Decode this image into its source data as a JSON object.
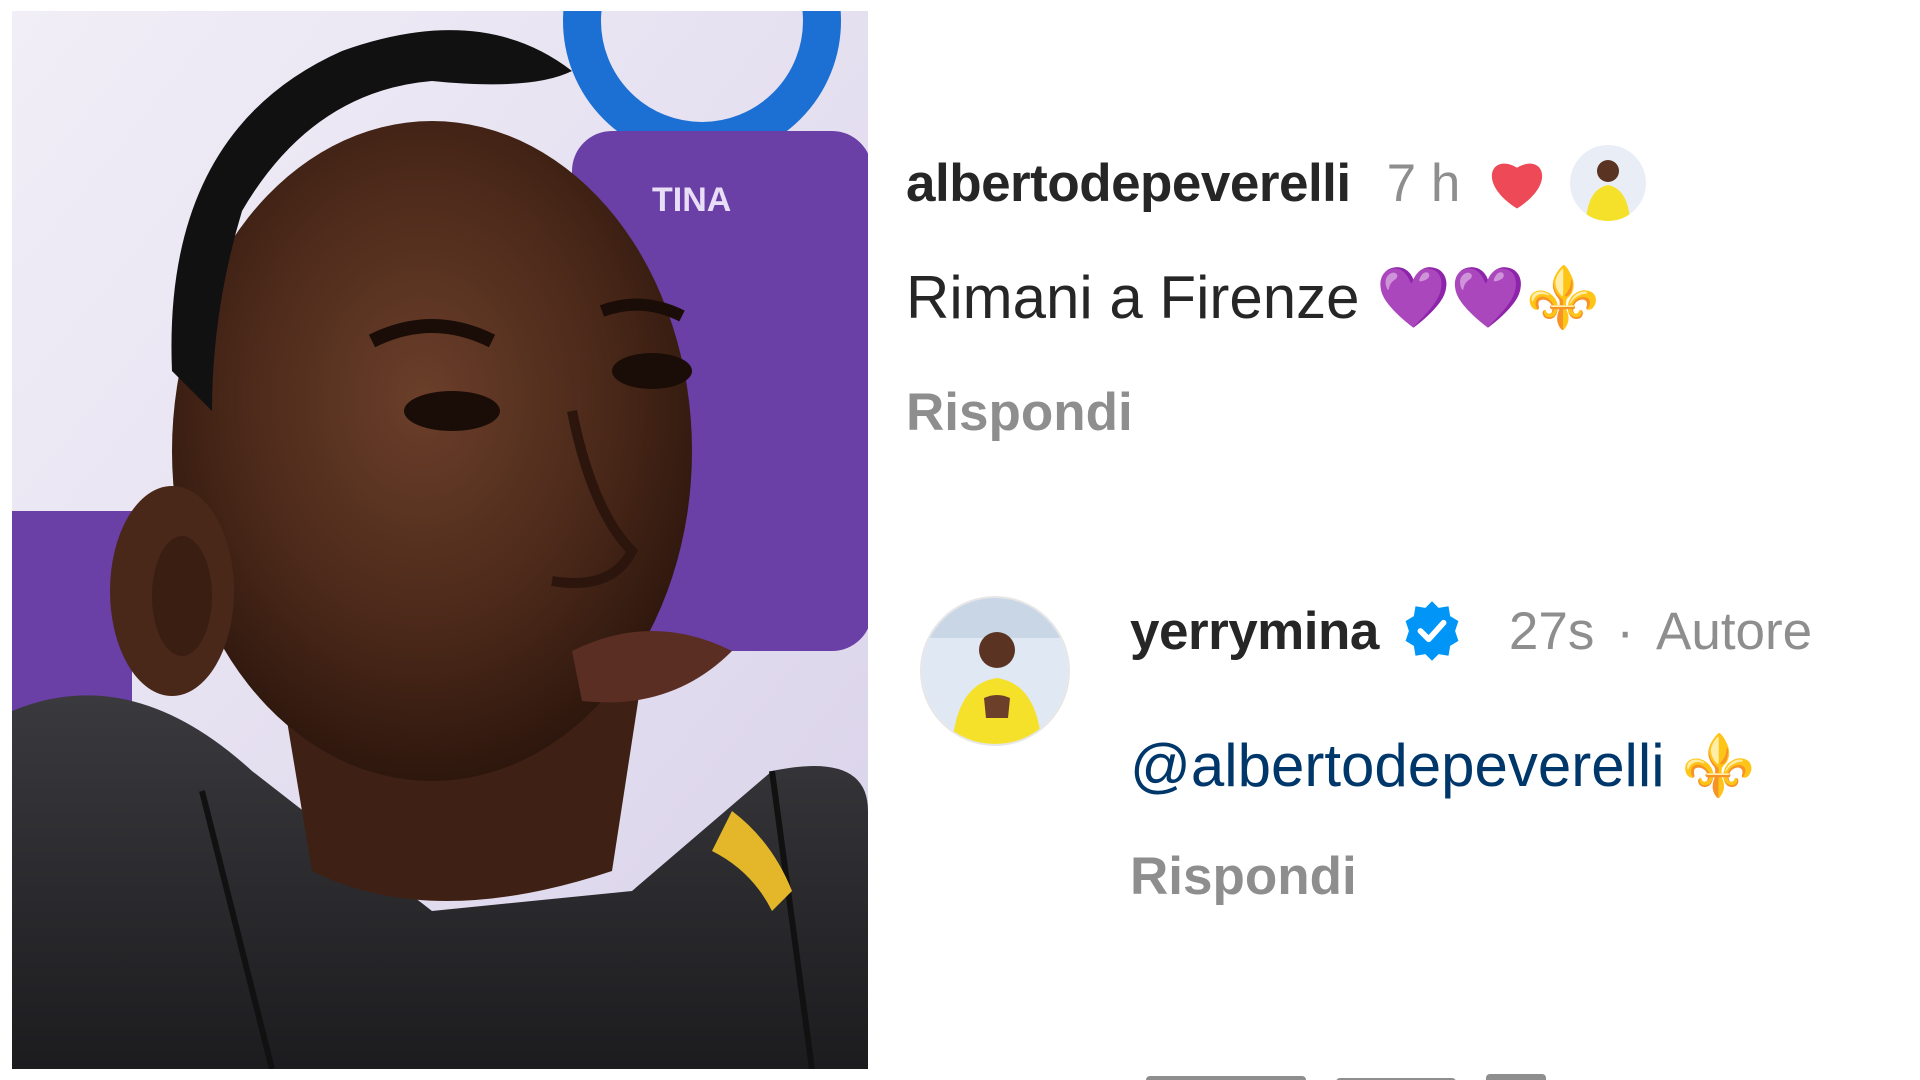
{
  "comments": [
    {
      "username": "albertodepeverelli",
      "time": "7 h",
      "liked_by_author": true,
      "text": "Rimani a Firenze",
      "text_emoji": "💜💜⚜️",
      "reply_label": "Rispondi"
    },
    {
      "username": "yerrymina",
      "verified": true,
      "time": "27s",
      "separator": "·",
      "author_label": "Autore",
      "mention": "@albertodepeverelli",
      "text_emoji": "⚜️",
      "reply_label": "Rispondi"
    }
  ],
  "colors": {
    "username": "#262626",
    "meta": "#8e8e8e",
    "mention": "#00376b",
    "heart": "#ed4956",
    "verified": "#0095f6",
    "jersey": "#f5e12a"
  },
  "icons": {
    "heart": "heart-icon",
    "verified": "verified-badge-icon",
    "fleur": "fleur-de-lis-emoji"
  }
}
